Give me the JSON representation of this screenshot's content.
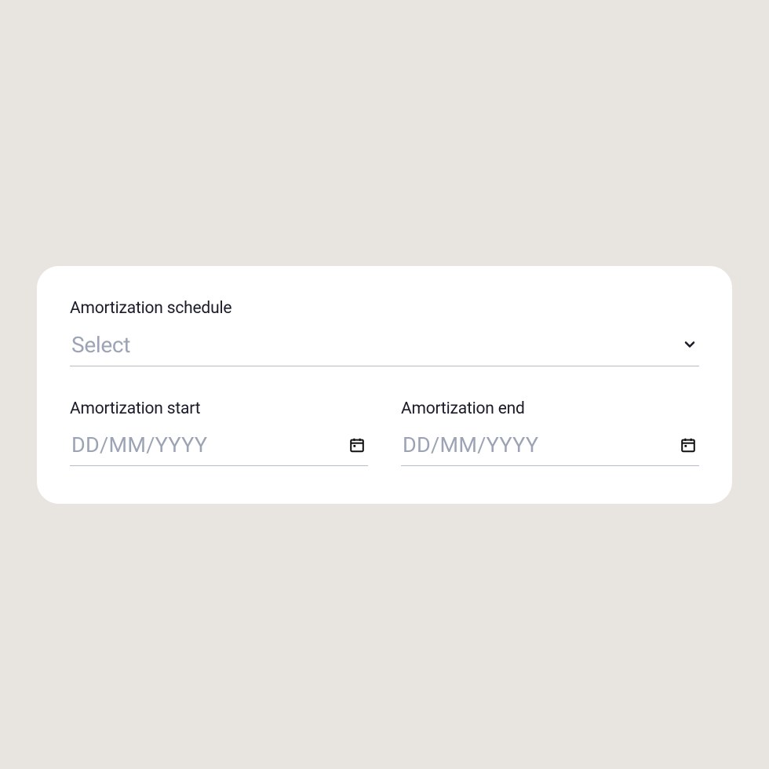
{
  "form": {
    "schedule": {
      "label": "Amortization schedule",
      "placeholder": "Select",
      "value": ""
    },
    "start": {
      "label": "Amortization start",
      "placeholder": "DD/MM/YYYY",
      "value": ""
    },
    "end": {
      "label": "Amortization end",
      "placeholder": "DD/MM/YYYY",
      "value": ""
    }
  }
}
